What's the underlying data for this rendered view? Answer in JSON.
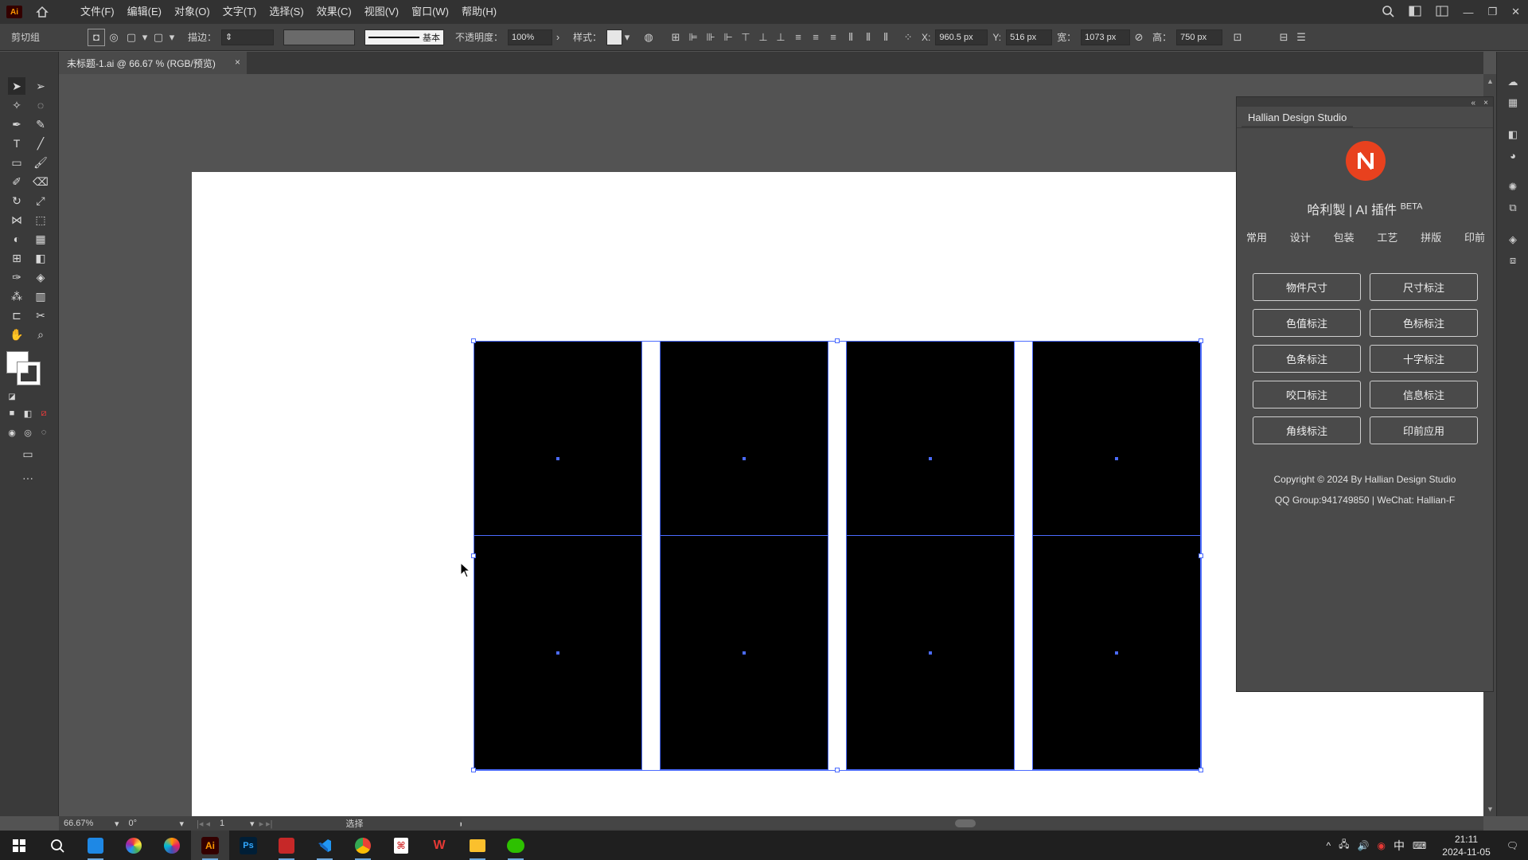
{
  "app": {
    "logo_text": "Ai",
    "menus": [
      "文件(F)",
      "编辑(E)",
      "对象(O)",
      "文字(T)",
      "选择(S)",
      "效果(C)",
      "视图(V)",
      "窗口(W)",
      "帮助(H)"
    ]
  },
  "control_bar": {
    "selection_label": "剪切组",
    "stroke_label": "描边：",
    "stroke_style_label": "基本",
    "opacity_label": "不透明度：",
    "opacity_value": "100%",
    "style_label": "样式：",
    "x_label": "X:",
    "x_value": "960.5 px",
    "y_label": "Y:",
    "y_value": "516 px",
    "w_label": "宽：",
    "w_value": "1073 px",
    "h_label": "高：",
    "h_value": "750 px"
  },
  "document": {
    "tab_title": "未标题-1.ai @ 66.67 % (RGB/预览)",
    "close_glyph": "×"
  },
  "status_bar": {
    "zoom": "66.67%",
    "rotation": "0°",
    "artboard_number": "1",
    "current_tool": "选择"
  },
  "plugin": {
    "tab_title": "Hallian Design Studio",
    "collapse_glyph": "«",
    "close_glyph": "×",
    "title": "哈利製 | AI 插件",
    "title_suffix": "BETA",
    "nav": [
      "常用",
      "设计",
      "包装",
      "工艺",
      "拼版",
      "印前"
    ],
    "buttons": [
      "物件尺寸",
      "尺寸标注",
      "色值标注",
      "色标标注",
      "色条标注",
      "十字标注",
      "咬口标注",
      "信息标注",
      "角线标注",
      "印前应用"
    ],
    "copyright": "Copyright © 2024 By Hallian Design Studio",
    "contact": "QQ Group:941749850 | WeChat: Hallian-F",
    "logo_color": "#e8411e"
  },
  "taskbar": {
    "time": "21:11",
    "date": "2024-11-05",
    "ime": "中"
  },
  "colors": {
    "selection": "#4b6bff",
    "accent_orange": "#ff9a00"
  }
}
